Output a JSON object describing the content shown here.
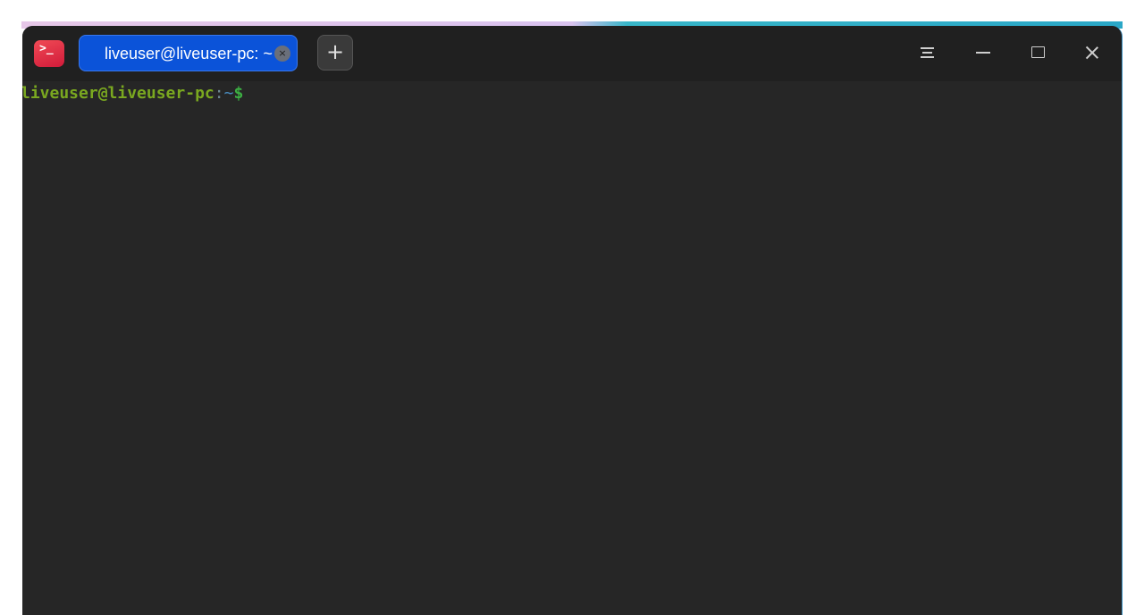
{
  "window": {
    "app_icon": "terminal-icon",
    "app_icon_glyph": ">_",
    "accent_color": "#0b53d9",
    "background_color": "#262626"
  },
  "tabs": [
    {
      "label": "liveuser@liveuser-pc: ~",
      "active": true,
      "close_glyph": "×"
    }
  ],
  "toolbar": {
    "new_tab_glyph": "+",
    "menu_icon": "menu-icon",
    "minimize_icon": "minimize-icon",
    "maximize_icon": "maximize-icon",
    "close_icon": "close-icon"
  },
  "terminal": {
    "prompt": {
      "user_host": "liveuser@liveuser-pc",
      "separator": ":",
      "path": "~",
      "symbol": "$"
    },
    "colors": {
      "user_host": "#7aa820",
      "path": "#4a8ec2",
      "symbol": "#3cb043"
    }
  }
}
